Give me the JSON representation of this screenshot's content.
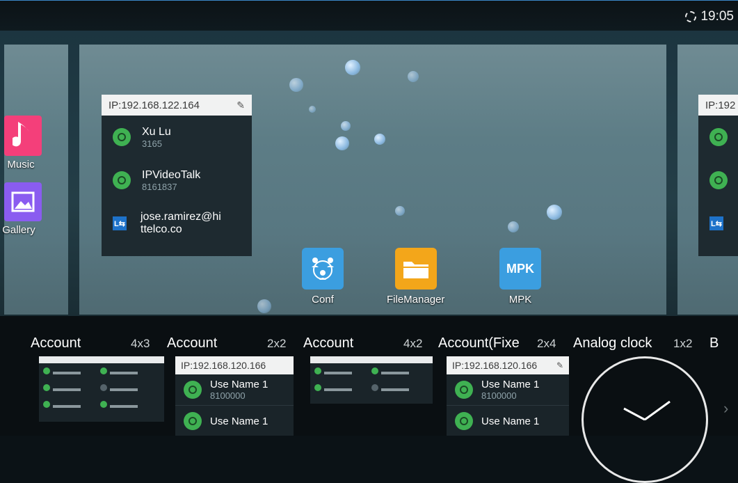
{
  "status_bar": {
    "time": "19:05",
    "sync_icon": "sync-icon"
  },
  "left_apps": [
    {
      "label": "Music",
      "icon": "music-note-icon",
      "color": "#f43f7a"
    },
    {
      "label": "Gallery",
      "icon": "gallery-image-icon",
      "color": "#8a5cf0"
    }
  ],
  "center_apps": [
    {
      "label": "Conf",
      "icon": "conference-icon",
      "color": "#3b9ee0"
    },
    {
      "label": "FileManager",
      "icon": "folder-icon",
      "color": "#f3a61a"
    },
    {
      "label": "MPK",
      "icon_text": "MPK",
      "color": "#3b9ee0"
    }
  ],
  "account_widget": {
    "header": "IP:192.168.122.164",
    "pin_icon": "pin-icon",
    "rows": [
      {
        "name": "Xu Lu",
        "number": "3165",
        "icon": "contact-icon"
      },
      {
        "name": "IPVideoTalk",
        "number": "8161837",
        "icon": "contact-icon"
      },
      {
        "name": "jose.ramirez@hi",
        "name2": "ttelco.co",
        "icon": "lync-icon"
      }
    ]
  },
  "right_widget": {
    "header": "IP:192"
  },
  "widget_tray": [
    {
      "title": "Account",
      "size": "4x3"
    },
    {
      "title": "Account",
      "size": "2x2",
      "preview_header": "IP:192.168.120.166",
      "rows": [
        {
          "name": "Use Name 1",
          "number": "8100000"
        },
        {
          "name": "Use Name 1",
          "number": ""
        }
      ]
    },
    {
      "title": "Account",
      "size": "4x2"
    },
    {
      "title": "Account(Fixe",
      "size": "2x4",
      "preview_header": "IP:192.168.120.166",
      "rows": [
        {
          "name": "Use Name 1",
          "number": "8100000"
        },
        {
          "name": "Use Name 1",
          "number": ""
        }
      ]
    },
    {
      "title": "Analog clock",
      "size": "1x2"
    },
    {
      "title": "B",
      "size": ""
    }
  ],
  "colors": {
    "accent": "#3fb152",
    "header_bg": "#f1f2f2"
  }
}
